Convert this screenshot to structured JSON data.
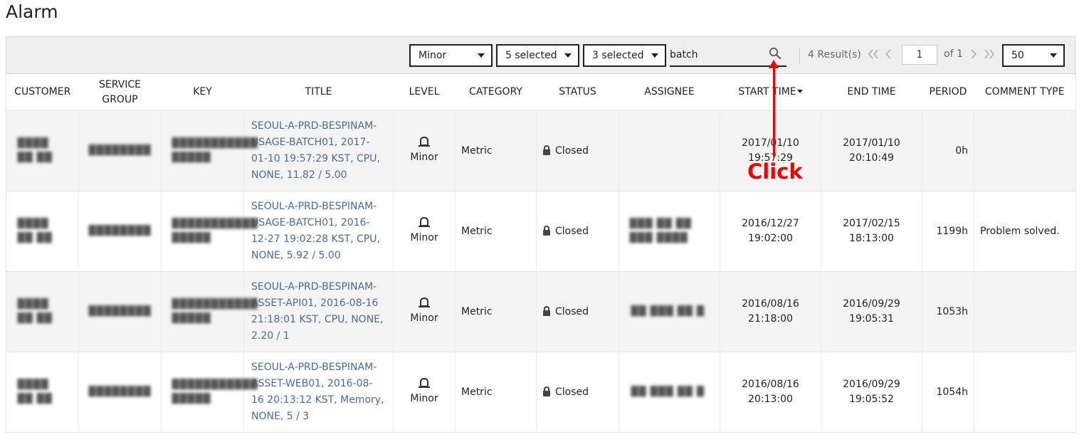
{
  "page": {
    "title": "Alarm"
  },
  "toolbar": {
    "level_filter": "Minor",
    "category_filter": "5 selected",
    "status_filter": "3 selected",
    "search_value": "batch",
    "result_count": "4 Result(s)",
    "page_number": "1",
    "page_total": "of 1",
    "page_size": "50"
  },
  "table": {
    "headers": {
      "customer": "CUSTOMER",
      "service_group_1": "SERVICE",
      "service_group_2": "GROUP",
      "key": "KEY",
      "title": "TITLE",
      "level": "LEVEL",
      "category": "CATEGORY",
      "status": "STATUS",
      "assignee": "ASSIGNEE",
      "start_time": "START TIME",
      "end_time": "END TIME",
      "period": "PERIOD",
      "comment_type": "COMMENT TYPE"
    },
    "rows": [
      {
        "customer": "████ ██ ██",
        "service_group": "████████",
        "key": "███████████ █████",
        "title_lines": [
          "SEOUL-A-PRD-BESPINAM-",
          "USAGE-BATCH01, 2017-",
          "01-10 19:57:29 KST, CPU,",
          "NONE, 11.82 / 5.00"
        ],
        "level": "Minor",
        "category": "Metric",
        "status": "Closed",
        "assignee": "",
        "start_date": "2017/01/10",
        "start_clock": "19:57:29",
        "end_date": "2017/01/10",
        "end_clock": "20:10:49",
        "period": "0h",
        "comment": ""
      },
      {
        "customer": "████ ██ ██",
        "service_group": "████████",
        "key": "███████████ █████",
        "title_lines": [
          "SEOUL-A-PRD-BESPINAM-",
          "USAGE-BATCH01, 2016-",
          "12-27 19:02:28 KST, CPU,",
          "NONE, 5.92 / 5.00"
        ],
        "level": "Minor",
        "category": "Metric",
        "status": "Closed",
        "assignee": "███ ██ ██ ███ ████",
        "start_date": "2016/12/27",
        "start_clock": "19:02:00",
        "end_date": "2017/02/15",
        "end_clock": "18:13:00",
        "period": "1199h",
        "comment": "Problem solved."
      },
      {
        "customer": "████ ██ ██",
        "service_group": "████████",
        "key": "███████████ █████",
        "title_lines": [
          "SEOUL-A-PRD-BESPINAM-",
          "ASSET-API01, 2016-08-16",
          "21:18:01 KST, CPU, NONE,",
          "2.20 / 1"
        ],
        "level": "Minor",
        "category": "Metric",
        "status": "Closed",
        "assignee": "██ ███ ██ █",
        "start_date": "2016/08/16",
        "start_clock": "21:18:00",
        "end_date": "2016/09/29",
        "end_clock": "19:05:31",
        "period": "1053h",
        "comment": ""
      },
      {
        "customer": "████ ██ ██",
        "service_group": "████████",
        "key": "███████████ █████",
        "title_lines": [
          "SEOUL-A-PRD-BESPINAM-",
          "ASSET-WEB01, 2016-08-",
          "16 20:13:12 KST, Memory,",
          "NONE, 5 / 3"
        ],
        "level": "Minor",
        "category": "Metric",
        "status": "Closed",
        "assignee": "██ ███ ██ █",
        "start_date": "2016/08/16",
        "start_clock": "20:13:00",
        "end_date": "2016/09/29",
        "end_clock": "19:05:52",
        "period": "1054h",
        "comment": ""
      }
    ]
  },
  "annotation": {
    "text": "Click",
    "color": "#e00000"
  },
  "icons": [
    "search-icon",
    "first-page-icon",
    "prev-page-icon",
    "next-page-icon",
    "last-page-icon",
    "bell-icon",
    "lock-icon",
    "sort-desc-icon",
    "chevron-down-icon"
  ]
}
